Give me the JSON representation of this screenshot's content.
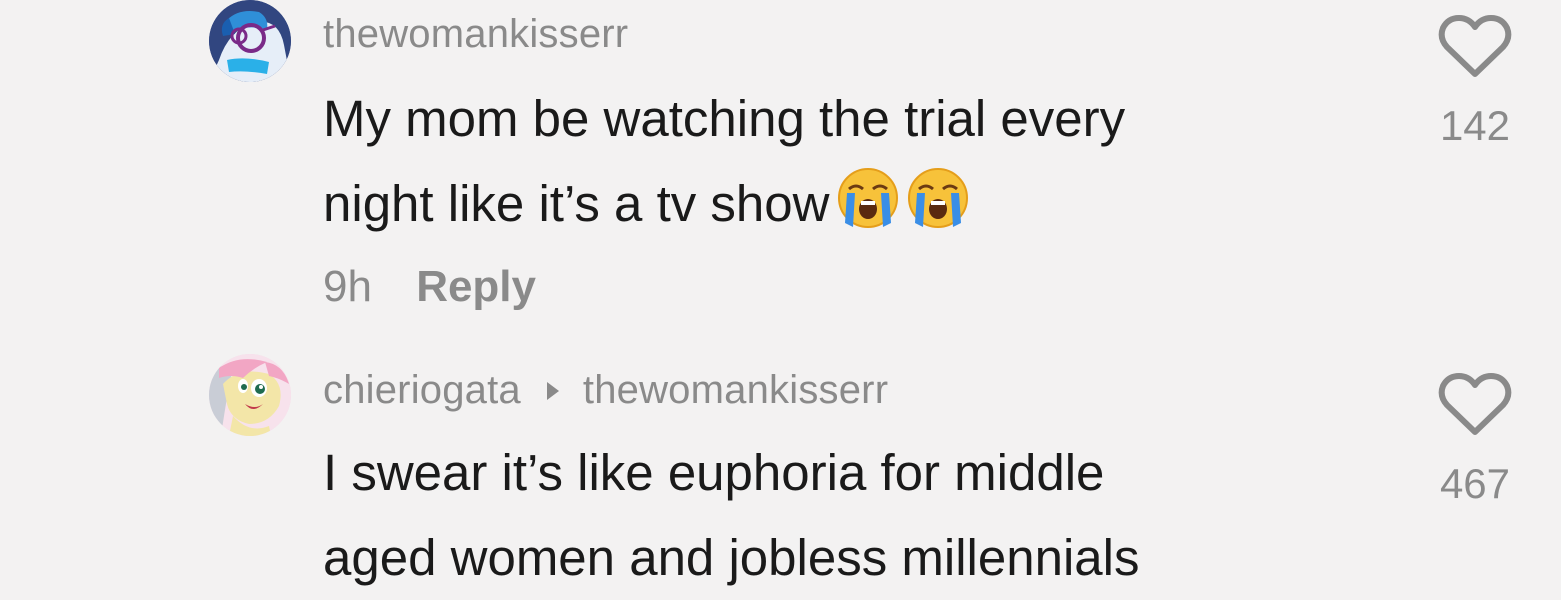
{
  "comments": [
    {
      "username": "thewomankisserr",
      "lines": [
        "My mom be watching the trial every",
        "night like it’s a tv show"
      ],
      "emojis": [
        "loudly-crying-face",
        "loudly-crying-face"
      ],
      "time": "9h",
      "reply_label": "Reply",
      "likes": "142"
    },
    {
      "username": "chieriogata",
      "reply_to": "thewomankisserr",
      "lines": [
        "I swear it’s like euphoria for middle",
        "aged women and jobless millennials"
      ],
      "likes": "467"
    }
  ],
  "icons": {
    "like": "heart-outline-icon",
    "reply_to": "caret-right-icon"
  },
  "colors": {
    "background": "#f3f2f2",
    "muted_text": "#8a8a8a",
    "body_text": "#1a1a1a"
  }
}
